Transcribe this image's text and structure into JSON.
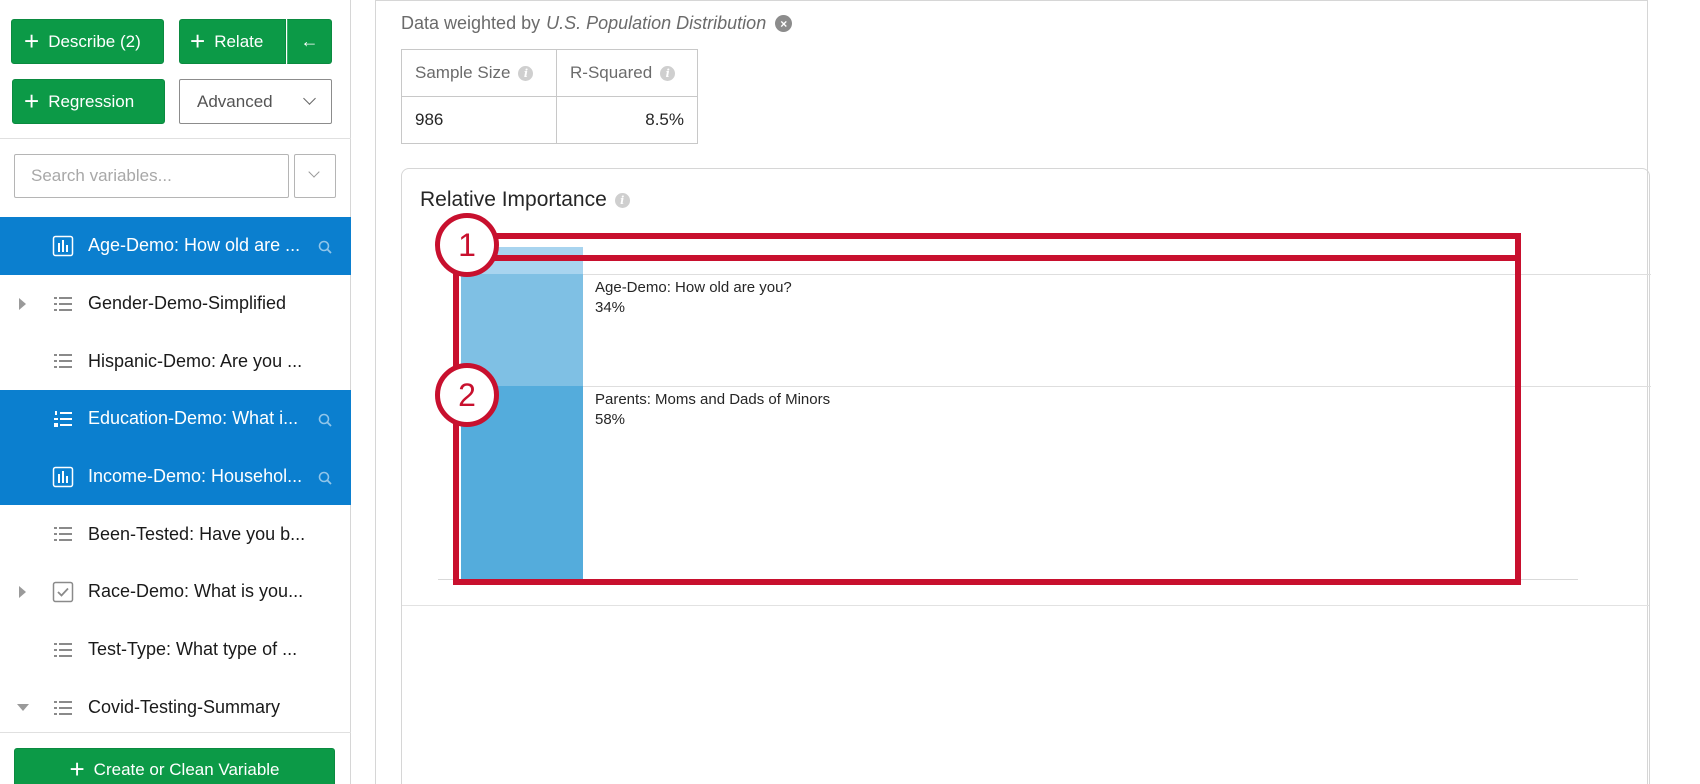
{
  "sidebar": {
    "describe_label": "Describe (2)",
    "relate_label": "Relate",
    "back_label": "←",
    "regression_label": "Regression",
    "advanced_label": "Advanced",
    "search_placeholder": "Search variables...",
    "create_label": "Create or Clean Variable",
    "items": [
      {
        "label": "Age-Demo: How old are ...",
        "icon": "bar-chart-icon",
        "selected": true,
        "caret": ""
      },
      {
        "label": "Gender-Demo-Simplified",
        "icon": "list-icon",
        "selected": false,
        "caret": "right"
      },
      {
        "label": "Hispanic-Demo: Are you ...",
        "icon": "list-icon",
        "selected": false,
        "caret": ""
      },
      {
        "label": "Education-Demo: What i...",
        "icon": "ordered-list-icon",
        "selected": true,
        "caret": ""
      },
      {
        "label": "Income-Demo: Househol...",
        "icon": "bar-chart-icon",
        "selected": true,
        "caret": ""
      },
      {
        "label": "Been-Tested: Have you b...",
        "icon": "list-icon",
        "selected": false,
        "caret": ""
      },
      {
        "label": "Race-Demo: What is you...",
        "icon": "checkbox-icon",
        "selected": false,
        "caret": "right"
      },
      {
        "label": "Test-Type: What type of ...",
        "icon": "list-icon",
        "selected": false,
        "caret": ""
      },
      {
        "label": "Covid-Testing-Summary",
        "icon": "list-icon",
        "selected": false,
        "caret": "down"
      }
    ]
  },
  "main": {
    "weight_prefix": "Data weighted by",
    "weight_name": "U.S. Population Distribution",
    "stats": {
      "headers": [
        "Sample Size",
        "R-Squared"
      ],
      "values": [
        "986",
        "8.5%"
      ]
    },
    "panel_title": "Relative Importance"
  },
  "chart_data": {
    "type": "bar",
    "title": "Relative Importance",
    "categories": [
      "",
      "Age-Demo: How old are you?",
      "Parents: Moms and Dads of Minors"
    ],
    "values": [
      8,
      34,
      58
    ],
    "value_labels": [
      "",
      "34%",
      "58%"
    ],
    "colors": [
      "#a8d4ef",
      "#7fc0e4",
      "#54acdc"
    ],
    "ylim": [
      0,
      100
    ]
  },
  "annotations": {
    "markers": [
      "1",
      "2"
    ],
    "color": "#c8102e"
  }
}
